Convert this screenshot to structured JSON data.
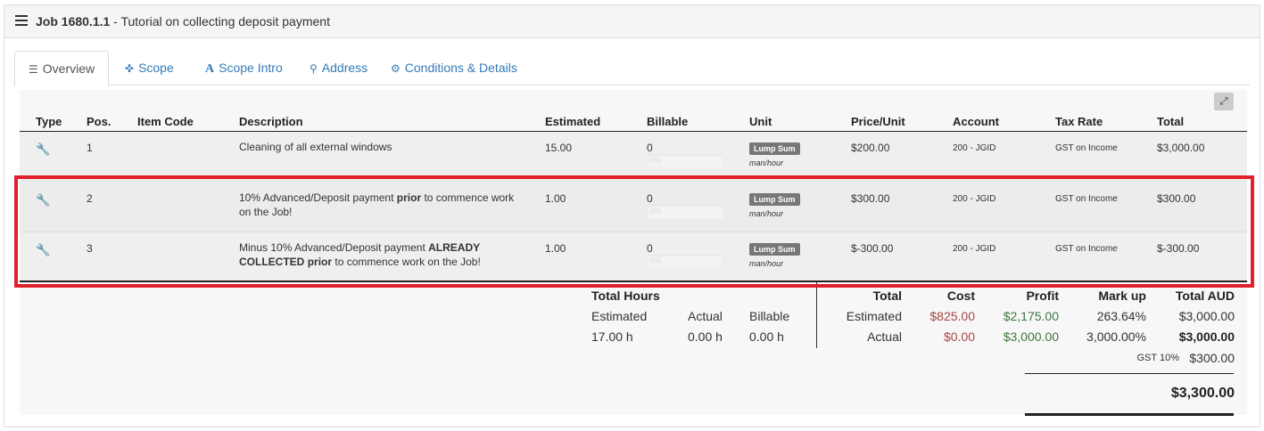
{
  "header": {
    "job_number": "Job 1680.1.1",
    "job_title": " - Tutorial on collecting deposit payment"
  },
  "tabs": [
    {
      "label": "Overview",
      "icon": "list-icon",
      "active": true
    },
    {
      "label": "Scope",
      "icon": "crosshairs-icon"
    },
    {
      "label": "Scope Intro",
      "icon": "font-icon"
    },
    {
      "label": "Address",
      "icon": "map-marker-icon"
    },
    {
      "label": "Conditions & Details",
      "icon": "gears-icon"
    }
  ],
  "table": {
    "headers": {
      "type": "Type",
      "pos": "Pos.",
      "item_code": "Item Code",
      "description": "Description",
      "estimated": "Estimated",
      "billable": "Billable",
      "unit": "Unit",
      "price_unit": "Price/Unit",
      "account": "Account",
      "tax_rate": "Tax Rate",
      "total": "Total"
    },
    "rows": [
      {
        "pos": "1",
        "desc_a": "Cleaning of all external windows",
        "desc_b": "",
        "desc_c": "",
        "desc_d": "",
        "desc_e": "",
        "estimated": "15.00",
        "billable": "0",
        "bill_pct": "0%",
        "unit_badge": "Lump Sum",
        "unit_sub": "man/hour",
        "price": "$200.00",
        "account": "200 - JGID",
        "tax": "GST on Income",
        "total": "$3,000.00"
      },
      {
        "pos": "2",
        "desc_a": "10% Advanced/Deposit payment ",
        "desc_b": "prior",
        "desc_c": " to commence work on the Job!",
        "desc_d": "",
        "desc_e": "",
        "estimated": "1.00",
        "billable": "0",
        "bill_pct": "0%",
        "unit_badge": "Lump Sum",
        "unit_sub": "man/hour",
        "price": "$300.00",
        "account": "200 - JGID",
        "tax": "GST on Income",
        "total": "$300.00"
      },
      {
        "pos": "3",
        "desc_a": "Minus 10% Advanced/Deposit payment ",
        "desc_b": "ALREADY COLLECTED",
        "desc_c": " ",
        "desc_d": "prior",
        "desc_e": " to commence work on the Job!",
        "estimated": "1.00",
        "billable": "0",
        "bill_pct": "0%",
        "unit_badge": "Lump Sum",
        "unit_sub": "man/hour",
        "price": "$-300.00",
        "account": "200 - JGID",
        "tax": "GST on Income",
        "total": "$-300.00"
      }
    ]
  },
  "summary": {
    "total_hours_label": "Total Hours",
    "estimated_label": "Estimated",
    "actual_label": "Actual",
    "billable_label": "Billable",
    "est_hours": "17.00 h",
    "actual_hours": "0.00 h",
    "billable_hours": "0.00 h",
    "total_label": "Total",
    "cost_label": "Cost",
    "profit_label": "Profit",
    "markup_label": "Mark up",
    "total_aud_label": "Total AUD",
    "row_estimated": "Estimated",
    "row_actual": "Actual",
    "est_cost": "$825.00",
    "est_profit": "$2,175.00",
    "est_markup": "263.64%",
    "est_total": "$3,000.00",
    "act_cost": "$0.00",
    "act_profit": "$3,000.00",
    "act_markup": "3,000.00%",
    "act_total": "$3,000.00",
    "gst_label": "GST 10%",
    "gst_value": "$300.00",
    "grand_total": "$3,300.00"
  },
  "colors": {
    "highlight_border": "#e0202a",
    "link": "#337ab7",
    "cost_red": "#a94442",
    "profit_green": "#3c763d"
  }
}
